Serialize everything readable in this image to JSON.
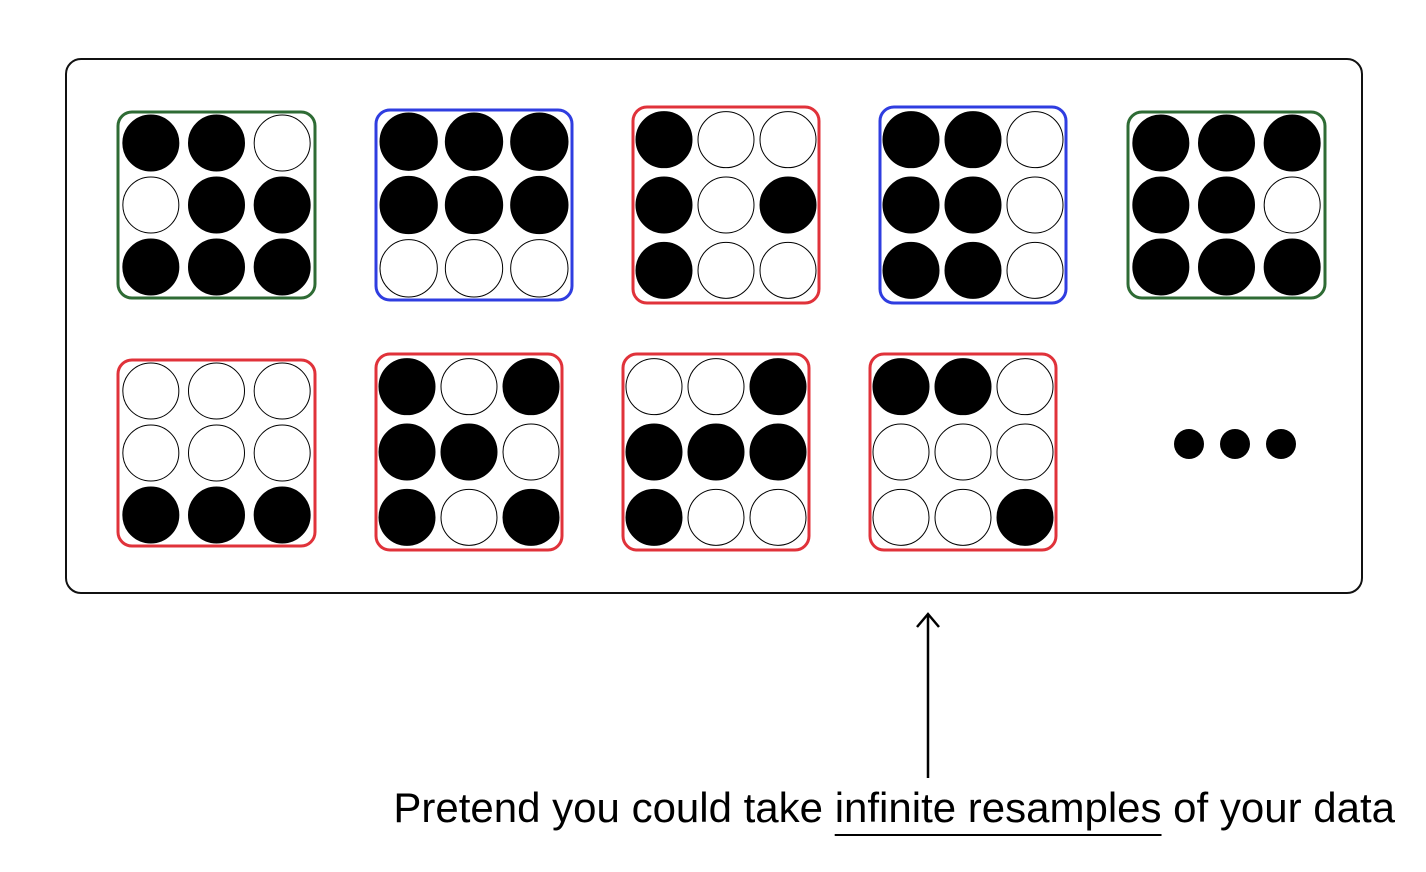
{
  "caption": {
    "before": "Pretend you could take ",
    "highlight": "infinite resamples",
    "after": " of your data"
  },
  "colors": {
    "green": "#2e6b34",
    "blue": "#2f3de0",
    "red": "#e0323a",
    "filled": "#000000",
    "empty": "#ffffff"
  },
  "samples": [
    {
      "frame": "green",
      "cells": [
        1,
        1,
        0,
        0,
        1,
        1,
        1,
        1,
        1
      ]
    },
    {
      "frame": "blue",
      "cells": [
        1,
        1,
        1,
        1,
        1,
        1,
        0,
        0,
        0
      ]
    },
    {
      "frame": "red",
      "cells": [
        1,
        0,
        0,
        1,
        0,
        1,
        1,
        0,
        0
      ]
    },
    {
      "frame": "blue",
      "cells": [
        1,
        1,
        0,
        1,
        1,
        0,
        1,
        1,
        0
      ]
    },
    {
      "frame": "green",
      "cells": [
        1,
        1,
        1,
        1,
        1,
        0,
        1,
        1,
        1
      ]
    },
    {
      "frame": "red",
      "cells": [
        0,
        0,
        0,
        0,
        0,
        0,
        1,
        1,
        1
      ]
    },
    {
      "frame": "red",
      "cells": [
        1,
        0,
        1,
        1,
        1,
        0,
        1,
        0,
        1
      ]
    },
    {
      "frame": "red",
      "cells": [
        0,
        0,
        1,
        1,
        1,
        1,
        1,
        0,
        0
      ]
    },
    {
      "frame": "red",
      "cells": [
        1,
        1,
        0,
        0,
        0,
        0,
        0,
        0,
        1
      ]
    }
  ],
  "continuation": "ellipsis-dots-icon",
  "pointer": "up-arrow-icon"
}
